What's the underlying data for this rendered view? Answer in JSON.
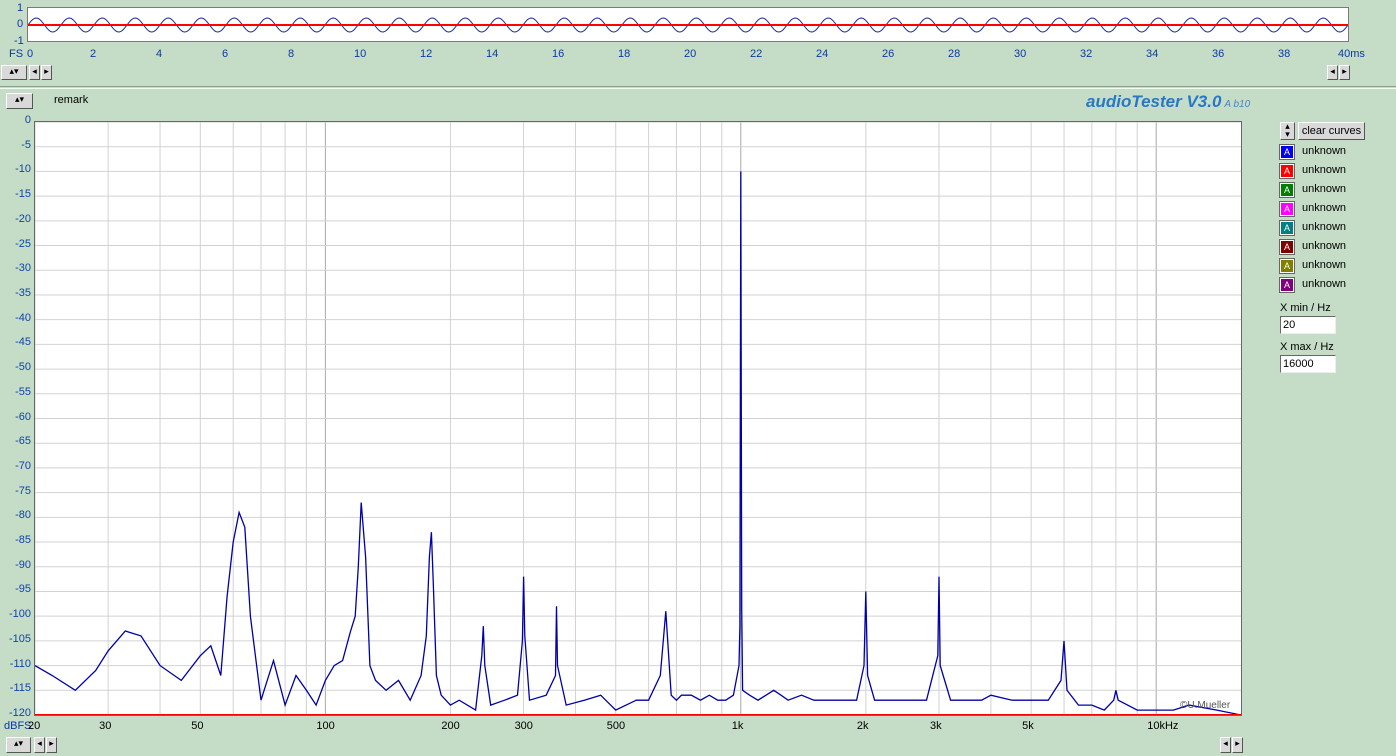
{
  "scope": {
    "y_labels": [
      "1",
      "0",
      "-1"
    ],
    "fs_label": "FS",
    "x_labels": [
      "0",
      "2",
      "4",
      "6",
      "8",
      "10",
      "12",
      "14",
      "16",
      "18",
      "20",
      "22",
      "24",
      "26",
      "28",
      "30",
      "32",
      "34",
      "36",
      "38",
      "40ms"
    ]
  },
  "remark_label": "remark",
  "app": {
    "title": "audioTester V3.0",
    "subtitle": "A b10"
  },
  "buttons": {
    "clear_curves": "clear curves"
  },
  "legend": [
    {
      "label": "unknown",
      "color": "#0000ff",
      "glyph": "A"
    },
    {
      "label": "unknown",
      "color": "#ff0000",
      "glyph": "A"
    },
    {
      "label": "unknown",
      "color": "#008000",
      "glyph": "A"
    },
    {
      "label": "unknown",
      "color": "#ff00ff",
      "glyph": "A"
    },
    {
      "label": "unknown",
      "color": "#008080",
      "glyph": "A"
    },
    {
      "label": "unknown",
      "color": "#800000",
      "glyph": "A"
    },
    {
      "label": "unknown",
      "color": "#808000",
      "glyph": "A"
    },
    {
      "label": "unknown",
      "color": "#800080",
      "glyph": "A"
    }
  ],
  "xmin": {
    "label": "X min / Hz",
    "value": "20"
  },
  "xmax": {
    "label": "X max / Hz",
    "value": "16000"
  },
  "y_unit": "dBFS",
  "copyright": "©U.Mueller",
  "chart_data": {
    "type": "line",
    "xscale": "log",
    "xlim": [
      20,
      16000
    ],
    "ylim": [
      -120,
      0
    ],
    "x_ticks": [
      20,
      30,
      50,
      100,
      200,
      300,
      500,
      1000,
      2000,
      3000,
      5000,
      10000
    ],
    "x_tick_labels": [
      "20",
      "30",
      "50",
      "100",
      "200",
      "300",
      "500",
      "1k",
      "2k",
      "3k",
      "5k",
      "10kHz"
    ],
    "y_ticks": [
      0,
      -5,
      -10,
      -15,
      -20,
      -25,
      -30,
      -35,
      -40,
      -45,
      -50,
      -55,
      -60,
      -65,
      -70,
      -75,
      -80,
      -85,
      -90,
      -95,
      -100,
      -105,
      -110,
      -115,
      -120
    ],
    "grid": true,
    "series": [
      {
        "color": "#0000aa",
        "x": [
          20,
          22,
          25,
          28,
          30,
          33,
          36,
          40,
          45,
          50,
          53,
          56,
          58,
          60,
          62,
          64,
          66,
          70,
          75,
          80,
          85,
          90,
          95,
          100,
          105,
          110,
          115,
          118,
          120,
          122,
          125,
          128,
          132,
          140,
          150,
          160,
          170,
          175,
          178,
          180,
          182,
          185,
          190,
          200,
          210,
          230,
          238,
          240,
          242,
          250,
          270,
          290,
          298,
          300,
          302,
          310,
          340,
          358,
          360,
          362,
          380,
          420,
          460,
          500,
          560,
          600,
          640,
          660,
          680,
          700,
          720,
          760,
          800,
          840,
          880,
          920,
          960,
          990,
          995,
          1000,
          1005,
          1010,
          1050,
          1100,
          1150,
          1200,
          1250,
          1300,
          1400,
          1500,
          1600,
          1700,
          1800,
          1900,
          1980,
          2000,
          2020,
          2100,
          2200,
          2400,
          2600,
          2800,
          2980,
          3000,
          3020,
          3200,
          3500,
          3800,
          4000,
          4500,
          5000,
          5500,
          5900,
          6000,
          6100,
          6500,
          7000,
          7500,
          7900,
          8000,
          8100,
          9000,
          10000,
          11000,
          12000,
          14000,
          16000
        ],
        "y": [
          -110,
          -112,
          -115,
          -111,
          -107,
          -103,
          -104,
          -110,
          -113,
          -108,
          -106,
          -112,
          -96,
          -85,
          -79,
          -82,
          -100,
          -117,
          -109,
          -118,
          -112,
          -115,
          -118,
          -113,
          -110,
          -109,
          -103,
          -100,
          -90,
          -77,
          -88,
          -110,
          -113,
          -115,
          -113,
          -117,
          -112,
          -104,
          -88,
          -83,
          -94,
          -112,
          -116,
          -118,
          -117,
          -119,
          -108,
          -102,
          -110,
          -118,
          -117,
          -116,
          -105,
          -92,
          -104,
          -117,
          -116,
          -112,
          -98,
          -110,
          -118,
          -117,
          -116,
          -119,
          -117,
          -117,
          -112,
          -99,
          -116,
          -117,
          -116,
          -116,
          -117,
          -116,
          -117,
          -117,
          -116,
          -110,
          -102,
          -10,
          -98,
          -115,
          -116,
          -117,
          -116,
          -115,
          -116,
          -117,
          -116,
          -117,
          -117,
          -117,
          -117,
          -117,
          -110,
          -95,
          -112,
          -117,
          -117,
          -117,
          -117,
          -117,
          -108,
          -92,
          -110,
          -117,
          -117,
          -117,
          -116,
          -117,
          -117,
          -117,
          -113,
          -105,
          -115,
          -118,
          -118,
          -119,
          -117,
          -115,
          -117,
          -119,
          -119,
          -119,
          -118,
          -119,
          -120
        ]
      },
      {
        "color": "#ff0000",
        "x": [
          20,
          16000
        ],
        "y": [
          -120,
          -120
        ]
      }
    ]
  }
}
